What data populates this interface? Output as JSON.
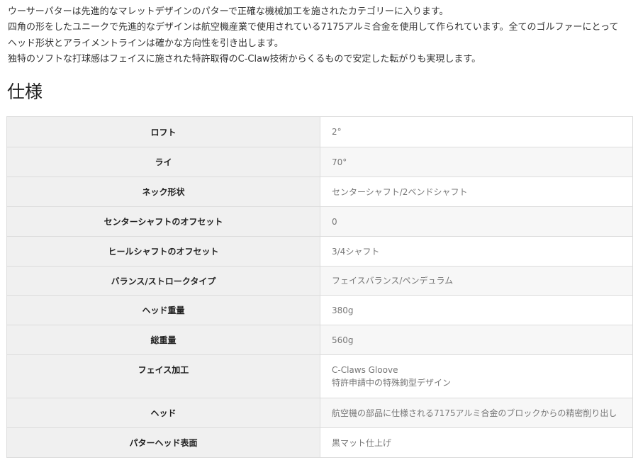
{
  "intro": {
    "line1": "ウーサーパターは先進的なマレットデザインのパターで正確な機械加工を施されたカテゴリーに入ります。",
    "line2": "四角の形をしたユニークで先進的なデザインは航空機産業で使用されている7175アルミ合金を使用して作られています。全てのゴルファーにとって",
    "line3": "ヘッド形状とアライメントラインは確かな方向性を引き出します。",
    "line4": "独特のソフトな打球感はフェイスに施された特許取得のC-Claw技術からくるもので安定した転がりも実現します。"
  },
  "section_title": "仕様",
  "specs": [
    {
      "label": "ロフト",
      "value": "2°"
    },
    {
      "label": "ライ",
      "value": "70°"
    },
    {
      "label": "ネック形状",
      "value": "センターシャフト/2ベンドシャフト"
    },
    {
      "label": "センターシャフトのオフセット",
      "value": "0"
    },
    {
      "label": "ヒールシャフトのオフセット",
      "value": "3/4シャフト"
    },
    {
      "label": "バランス/ストロークタイプ",
      "value": "フェイスバランス/ペンデュラム"
    },
    {
      "label": "ヘッド重量",
      "value": "380g"
    },
    {
      "label": "総重量",
      "value": "560g"
    },
    {
      "label": "フェイス加工",
      "value": "C-Claws Gloove",
      "value2": "特許申請中の特殊鉤型デザイン"
    },
    {
      "label": "ヘッド",
      "value": "航空機の部品に仕様される7175アルミ合金のブロックからの精密削り出し"
    },
    {
      "label": "パターヘッド表面",
      "value": "黒マット仕上げ"
    }
  ]
}
